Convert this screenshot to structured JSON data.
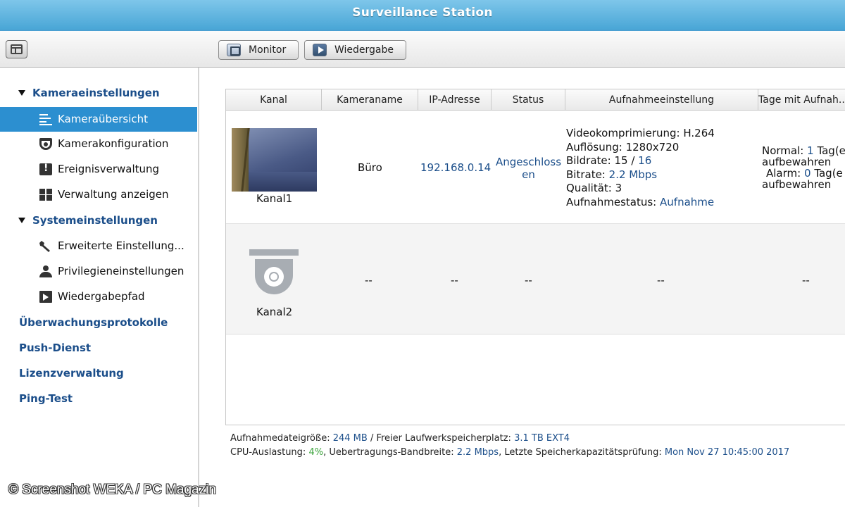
{
  "window": {
    "title": "Surveillance Station"
  },
  "toolbar": {
    "monitor_label": "Monitor",
    "playback_label": "Wiedergabe"
  },
  "sidebar": {
    "group1": {
      "label": "Kameraeinstellungen",
      "expanded": true
    },
    "group1_items": [
      {
        "label": "Kameraübersicht",
        "icon": "camera-list-icon",
        "active": true
      },
      {
        "label": "Kamerakonfiguration",
        "icon": "camera-icon"
      },
      {
        "label": "Ereignisverwaltung",
        "icon": "event-icon"
      },
      {
        "label": "Verwaltung anzeigen",
        "icon": "grid-icon"
      }
    ],
    "group2": {
      "label": "Systemeinstellungen",
      "expanded": true
    },
    "group2_items": [
      {
        "label": "Erweiterte Einstellung...",
        "icon": "wrench-icon"
      },
      {
        "label": "Privilegieneinstellungen",
        "icon": "user-icon"
      },
      {
        "label": "Wiedergabepfad",
        "icon": "playback-path-icon"
      }
    ],
    "links": [
      "Überwachungsprotokolle",
      "Push-Dienst",
      "Lizenzverwaltung",
      "Ping-Test"
    ]
  },
  "table": {
    "columns": [
      "Kanal",
      "Kameraname",
      "IP-Adresse",
      "Status",
      "Aufnahmeeinstellung",
      "Tage mit Aufnah..."
    ],
    "rows": [
      {
        "channel": "Kanal1",
        "camera_name": "Büro",
        "ip": "192.168.0.14",
        "status_line1": "Angeschloss",
        "status_line2": "en",
        "rec": {
          "compression_label": "Videokomprimierung:",
          "compression": "H.264",
          "resolution_label": "Auflösung:",
          "resolution": "1280x720",
          "framerate_label": "Bildrate:",
          "framerate_value": "15",
          "framerate_sep": "/",
          "framerate_max": "16",
          "bitrate_label": "Bitrate:",
          "bitrate": "2.2 Mbps",
          "quality_label": "Qualität:",
          "quality": "3",
          "status_label": "Aufnahmestatus:",
          "status": "Aufnahme"
        },
        "days": {
          "normal_label": "Normal:",
          "normal_value": "1",
          "normal_unit": "Tag(e",
          "keep": "aufbewahren",
          "alarm_label": "Alarm:",
          "alarm_value": "0",
          "alarm_unit": "Tag(e"
        }
      },
      {
        "channel": "Kanal2",
        "camera_name": "--",
        "ip": "--",
        "status": "--",
        "rec": "--",
        "days": "--"
      }
    ]
  },
  "footer": {
    "line1_label": "Aufnahmedateigröße:",
    "file_size": "244 MB",
    "line1_sep": "/ Freier Laufwerkspeicherplatz:",
    "free_space": "3.1 TB EXT4",
    "cpu_label": "CPU-Auslastung:",
    "cpu": "4%",
    "bandwidth_label": ", Uebertragungs-Bandbreite:",
    "bandwidth": "2.2 Mbps",
    "check_label": ", Letzte Speicherkapazitätsprüfung:",
    "check_time": "Mon Nov 27 10:45:00 2017"
  },
  "watermark": "© Screenshot WEKA / PC Magazin",
  "colors": {
    "accent": "#2c8fd0",
    "link": "#1b4e8a",
    "titlebar": "#5fb2de",
    "ok": "#3aa33a"
  }
}
